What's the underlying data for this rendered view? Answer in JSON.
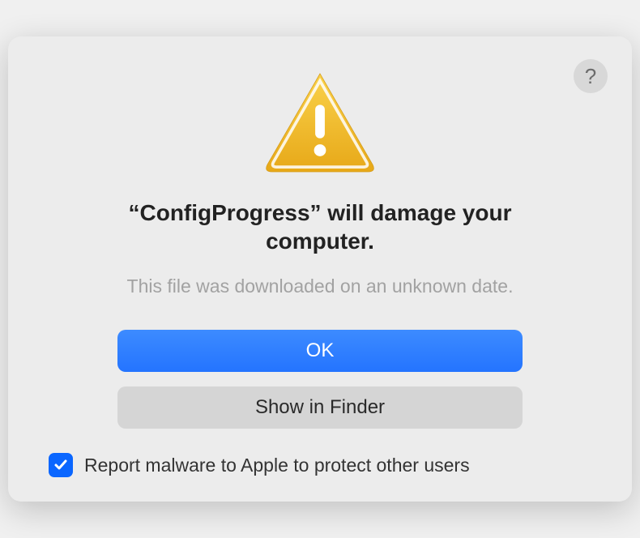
{
  "dialog": {
    "title": "“ConfigProgress” will damage your computer.",
    "subtitle": "This file was downloaded on an unknown date.",
    "buttons": {
      "ok": "OK",
      "show_in_finder": "Show in Finder"
    },
    "checkbox": {
      "label": "Report malware to Apple to protect other users",
      "checked": true
    },
    "help": "?"
  }
}
